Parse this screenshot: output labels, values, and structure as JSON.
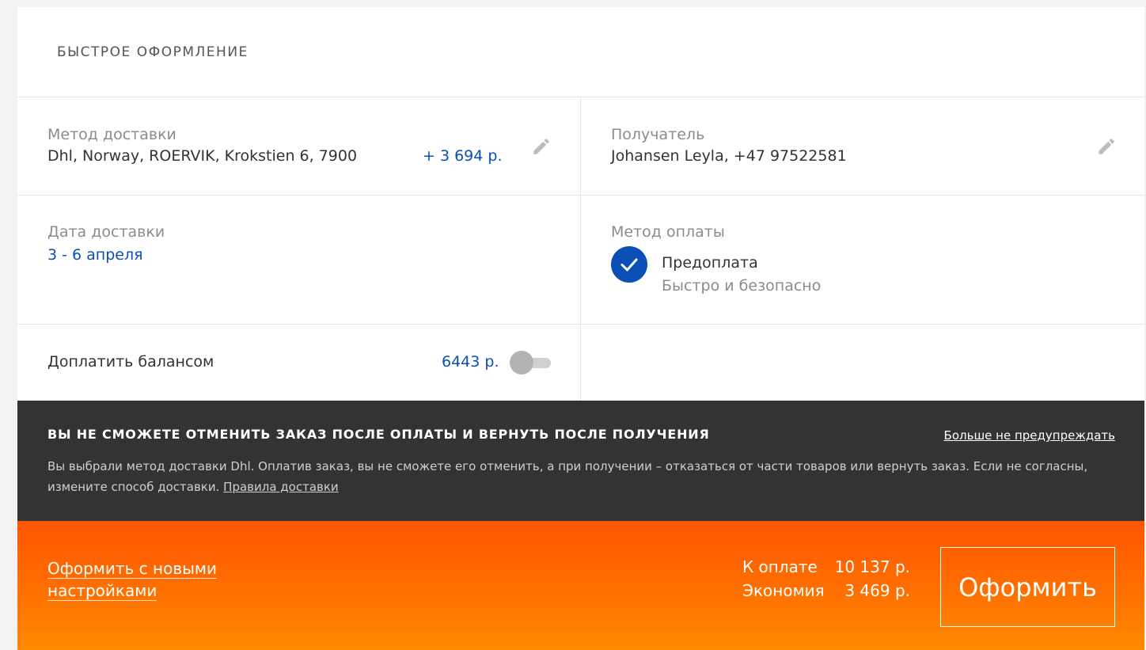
{
  "header": {
    "title": "БЫСТРОЕ ОФОРМЛЕНИЕ"
  },
  "delivery": {
    "label": "Метод доставки",
    "value": "Dhl, Norway, ROERVIK, Krokstien 6, 7900",
    "price": "+ 3 694 р.",
    "edit_icon": "pencil-icon"
  },
  "recipient": {
    "label": "Получатель",
    "value": "Johansen Leyla, +47 97522581",
    "edit_icon": "pencil-icon"
  },
  "delivery_date": {
    "label": "Дата доставки",
    "value": "3 - 6 апреля"
  },
  "payment": {
    "label": "Метод оплаты",
    "method": "Предоплата",
    "description": "Быстро и безопасно",
    "icon": "check-icon"
  },
  "balance": {
    "label": "Доплатить балансом",
    "amount": "6443 р.",
    "enabled": false
  },
  "warning": {
    "title": "ВЫ НЕ СМОЖЕТЕ ОТМЕНИТЬ ЗАКАЗ ПОСЛЕ ОПЛАТЫ И ВЕРНУТЬ ПОСЛЕ ПОЛУЧЕНИЯ",
    "dismiss": "Больше не предупреждать",
    "text": "Вы выбрали метод доставки Dhl. Оплатив заказ, вы не сможете его отменить, а при получении – отказаться от части товаров или вернуть заказ. Если не согласны, измените способ доставки.",
    "link": "Правила доставки"
  },
  "footer": {
    "link_line1": "Оформить с новыми",
    "link_line2": "настройками",
    "to_pay_label": "К оплате",
    "to_pay_value": "10 137 р.",
    "savings_label": "Экономия",
    "savings_value": "3 469 р.",
    "submit": "Оформить"
  },
  "colors": {
    "accent_blue": "#0b4fb5",
    "warning_bg": "#333333",
    "footer_orange": "#ff6a00"
  }
}
